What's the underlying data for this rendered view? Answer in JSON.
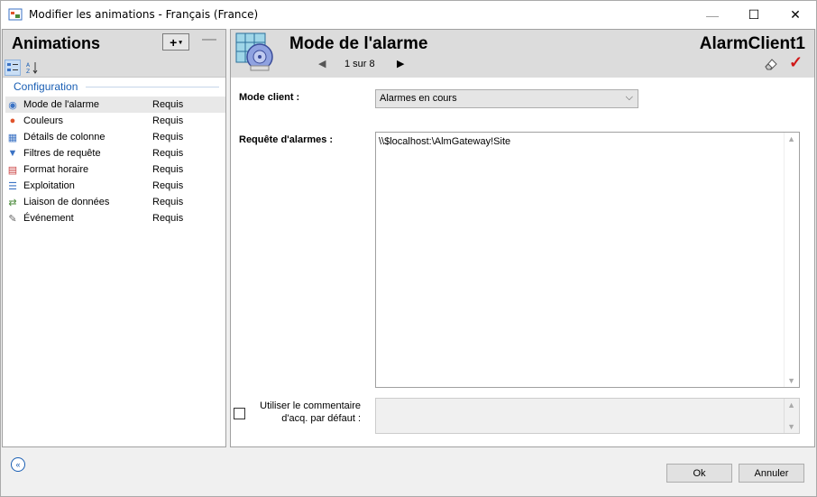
{
  "window": {
    "title": "Modifier les animations - Français (France)",
    "minimize_glyph": "—",
    "maximize_glyph": "☐",
    "close_glyph": "✕"
  },
  "left": {
    "title": "Animations",
    "add_glyph": "+",
    "collapse_glyph": "—",
    "section": "Configuration",
    "items": [
      {
        "label": "Mode de l'alarme",
        "status": "Requis",
        "icon": "alarm-mode-icon",
        "glyph": "◉",
        "color": "#3a72c4"
      },
      {
        "label": "Couleurs",
        "status": "Requis",
        "icon": "colors-icon",
        "glyph": "●",
        "color": "#e0542c"
      },
      {
        "label": "Détails de colonne",
        "status": "Requis",
        "icon": "columns-icon",
        "glyph": "▦",
        "color": "#3a72c4"
      },
      {
        "label": "Filtres de requête",
        "status": "Requis",
        "icon": "filter-icon",
        "glyph": "▼",
        "color": "#3a72c4"
      },
      {
        "label": "Format horaire",
        "status": "Requis",
        "icon": "time-format-icon",
        "glyph": "▤",
        "color": "#c83c3c"
      },
      {
        "label": "Exploitation",
        "status": "Requis",
        "icon": "operation-icon",
        "glyph": "☰",
        "color": "#3a72c4"
      },
      {
        "label": "Liaison de données",
        "status": "Requis",
        "icon": "data-binding-icon",
        "glyph": "⇄",
        "color": "#4a8a3a"
      },
      {
        "label": "Événement",
        "status": "Requis",
        "icon": "event-icon",
        "glyph": "✎",
        "color": "#666666"
      }
    ]
  },
  "right": {
    "title": "Mode de l'alarme",
    "object": "AlarmClient1",
    "nav": "1 sur 8",
    "mode_label": "Mode client :",
    "mode_value": "Alarmes en cours",
    "query_label": "Requête d'alarmes :",
    "query_value": "\\\\$localhost:\\AlmGateway!Site",
    "checkbox_label": "Utiliser le commentaire d'acq. par défaut :"
  },
  "footer": {
    "ok": "Ok",
    "cancel": "Annuler"
  },
  "colors": {
    "accent": "#1a5fb4",
    "check": "#d01818",
    "header_bg": "#dcdcdc"
  }
}
